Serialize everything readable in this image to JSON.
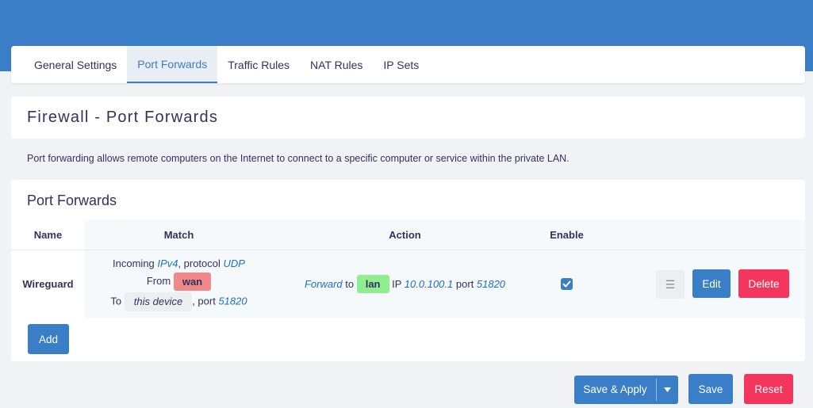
{
  "tabs": [
    "General Settings",
    "Port Forwards",
    "Traffic Rules",
    "NAT Rules",
    "IP Sets"
  ],
  "active_tab": "Port Forwards",
  "page_title": "Firewall - Port Forwards",
  "description": "Port forwarding allows remote computers on the Internet to connect to a specific computer or service within the private LAN.",
  "section_title": "Port Forwards",
  "columns": {
    "name": "Name",
    "match": "Match",
    "action": "Action",
    "enable": "Enable"
  },
  "rule": {
    "name": "Wireguard",
    "match": {
      "incoming_prefix": "Incoming ",
      "family": "IPv4",
      "protocol_prefix": ", protocol ",
      "protocol": "UDP",
      "from_label": "From",
      "from_zone": "wan",
      "to_label": "To",
      "to_target": "this device",
      "port_prefix": ", port ",
      "port": "51820"
    },
    "action": {
      "verb": "Forward",
      "to_word": " to ",
      "dest_zone": "lan",
      "ip_label": " IP ",
      "ip": "10.0.100.1",
      "port_label": " port ",
      "port": "51820"
    },
    "enabled": true
  },
  "buttons": {
    "edit": "Edit",
    "delete": "Delete",
    "add": "Add",
    "save_apply": "Save & Apply",
    "save": "Save",
    "reset": "Reset"
  },
  "colors": {
    "header": "#3a7ec8",
    "primary": "#3a7ec8",
    "danger": "#f5365c",
    "zone_wan": "#f08989",
    "zone_lan": "#90ee90"
  },
  "icons": {
    "drag_handle": "menu-lines-icon",
    "checkmark": "checkmark-icon",
    "dropdown": "caret-down-icon"
  }
}
